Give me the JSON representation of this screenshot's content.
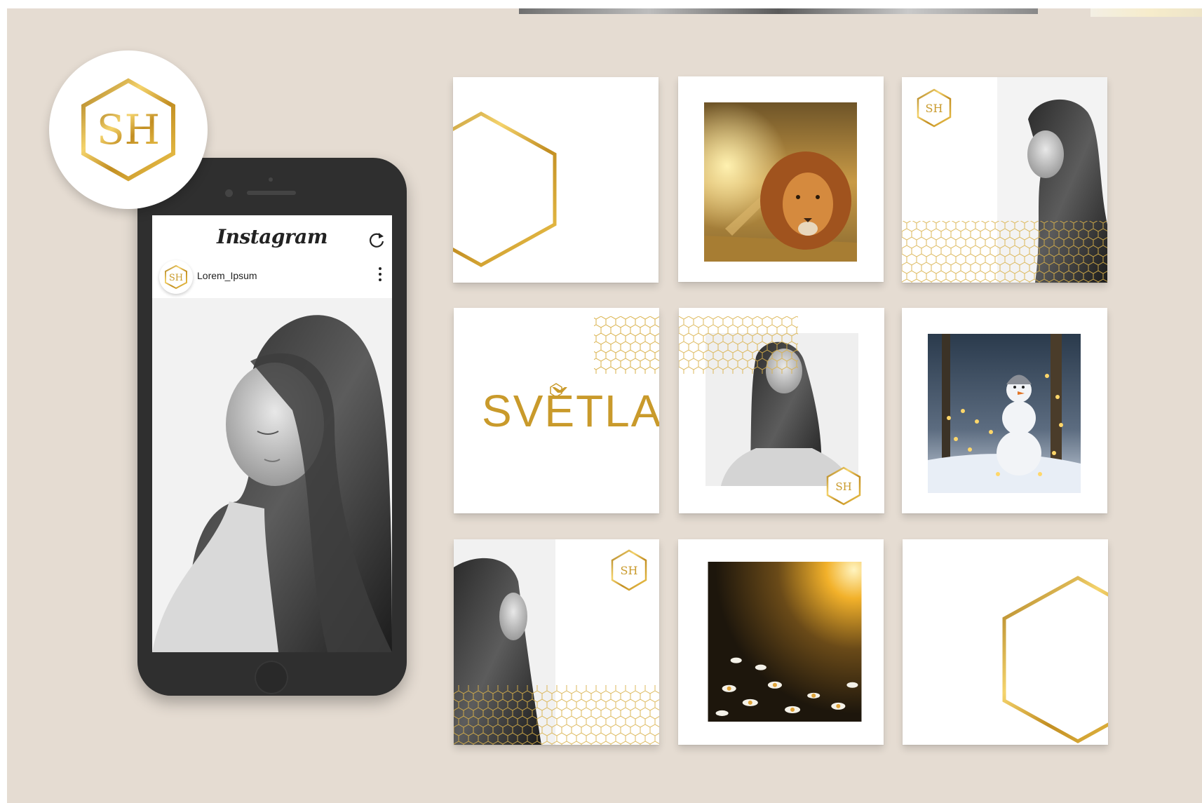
{
  "app": {
    "name": "Instagram"
  },
  "post": {
    "username": "Lorem_Ipsum"
  },
  "brand": {
    "wordmark": "SVĚTLA",
    "monogram": "SH",
    "accent": "#c99a2b",
    "accent_light": "#f0d27a",
    "background": "#e5dcd2"
  },
  "icons": {
    "refresh": "refresh-icon",
    "more": "more-vertical-icon",
    "logo": "hexagon-monogram-logo"
  },
  "grid": {
    "tiles": [
      {
        "name": "hexagon-outline-left"
      },
      {
        "name": "lion-photo"
      },
      {
        "name": "woman-portrait-honeycomb"
      },
      {
        "name": "svetla-wordmark"
      },
      {
        "name": "woman-portrait-center"
      },
      {
        "name": "snowman-photo"
      },
      {
        "name": "woman-portrait-left"
      },
      {
        "name": "daisies-sunset-photo"
      },
      {
        "name": "hexagon-outline-right"
      }
    ]
  }
}
